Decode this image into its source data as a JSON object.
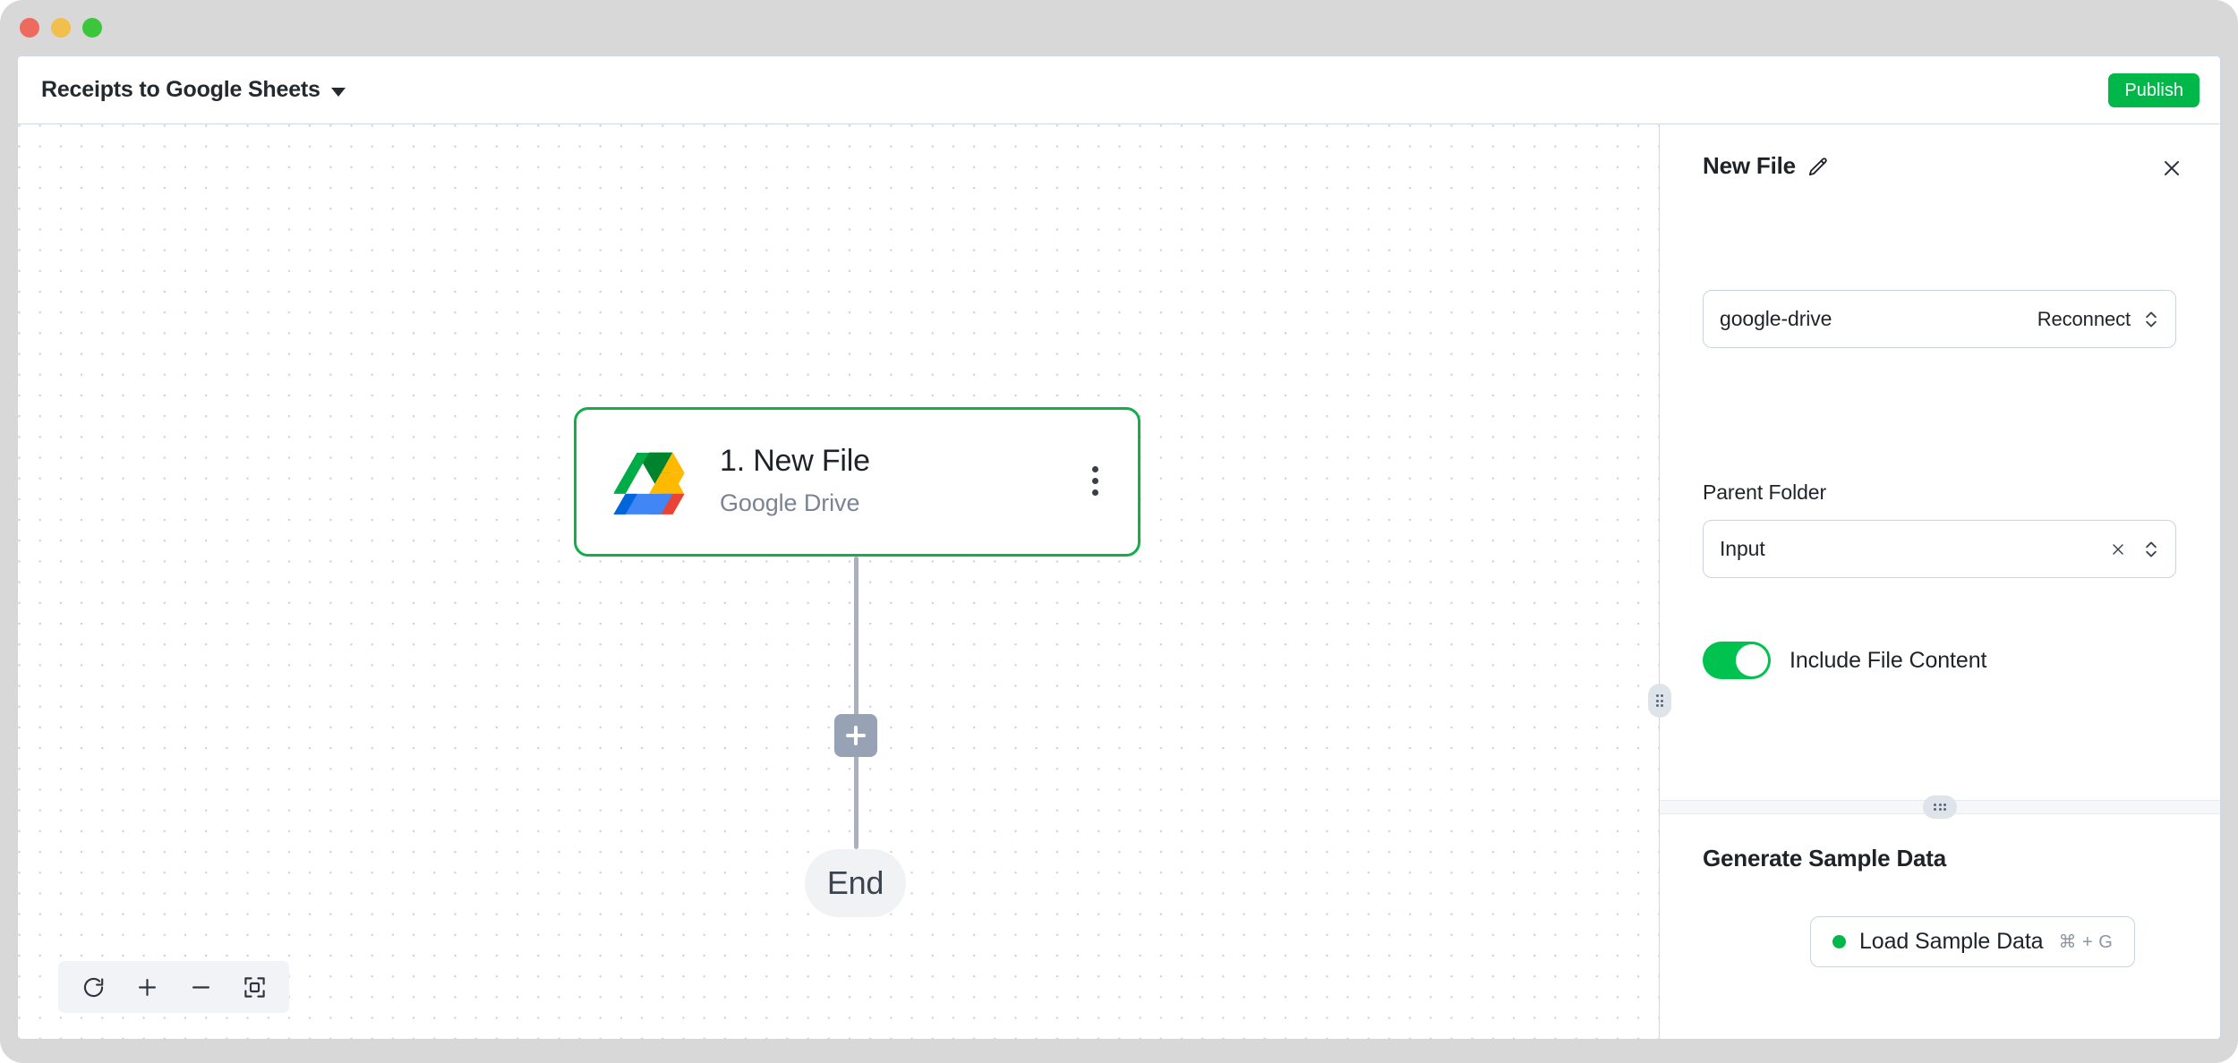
{
  "window": {
    "traffic_lights": [
      "close",
      "minimize",
      "maximize"
    ]
  },
  "topbar": {
    "flow_title": "Receipts to Google Sheets",
    "flow_title_caret": "chevron-down-icon",
    "publish_label": "Publish",
    "publish_color": "#00b84a"
  },
  "canvas": {
    "node": {
      "index_title": "1. New File",
      "subtitle": "Google Drive",
      "app_icon": "google-drive-icon",
      "menu_icon": "kebab-menu-icon",
      "selected_border_color": "#13ae4b"
    },
    "add_node_label": "+",
    "end_node_label": "End",
    "toolbar": {
      "items": [
        {
          "name": "reset-view",
          "icon": "refresh-icon"
        },
        {
          "name": "zoom-in",
          "icon": "plus-icon"
        },
        {
          "name": "zoom-out",
          "icon": "minus-icon"
        },
        {
          "name": "fit-to-screen",
          "icon": "fit-screen-icon"
        }
      ]
    }
  },
  "panel": {
    "title": "New File",
    "edit_icon": "pencil-icon",
    "close_icon": "close-icon",
    "connection": {
      "value": "google-drive",
      "action_label": "Reconnect",
      "stepper_icon": "chevron-updown-icon"
    },
    "parent_folder": {
      "label": "Parent Folder",
      "value": "Input",
      "clear_icon": "close-small-icon",
      "stepper_icon": "chevron-updown-icon"
    },
    "include_file_content": {
      "label": "Include File Content",
      "enabled": true,
      "on_color": "#00c24f"
    },
    "sample_data": {
      "section_title": "Generate Sample Data",
      "button_label": "Load Sample Data",
      "button_shortcut": "⌘ + G",
      "status_dot_color": "#00b84a"
    }
  }
}
